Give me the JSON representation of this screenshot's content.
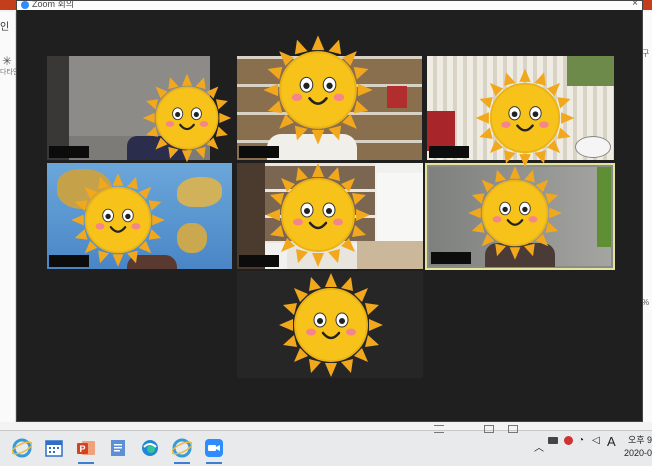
{
  "window": {
    "title": "Zoom 회의",
    "close_glyph": "×"
  },
  "background_app": {
    "left_label": "인",
    "left_sublabel": "다타인",
    "right_label_top": "구",
    "right_label_mid": "%"
  },
  "participants": [
    {
      "scene": "grey-room",
      "active": false,
      "overlay": "sun-emoji"
    },
    {
      "scene": "bookshelf",
      "active": false,
      "overlay": "sun-emoji"
    },
    {
      "scene": "curtain-room",
      "active": false,
      "overlay": "sun-emoji"
    },
    {
      "scene": "world-map",
      "active": false,
      "overlay": "sun-emoji"
    },
    {
      "scene": "office-shelves",
      "active": false,
      "overlay": "sun-emoji"
    },
    {
      "scene": "grey-wall",
      "active": true,
      "overlay": "sun-emoji"
    },
    {
      "scene": "dark",
      "active": false,
      "overlay": "sun-emoji"
    }
  ],
  "taskbar": {
    "apps": [
      {
        "name": "internet-explorer-icon",
        "color": "#3a9ad9"
      },
      {
        "name": "calendar-icon",
        "color": "#2f6fc6"
      },
      {
        "name": "powerpoint-icon",
        "color": "#d04423"
      },
      {
        "name": "word-doc-icon",
        "color": "#5b8fd6"
      },
      {
        "name": "edge-icon",
        "color": "#1f88d6"
      },
      {
        "name": "internet-explorer-icon-2",
        "color": "#3a9ad9"
      },
      {
        "name": "zoom-icon",
        "color": "#2d8cff"
      }
    ],
    "tray": {
      "ime": "A",
      "time": "오후 9",
      "date": "2020-0"
    }
  },
  "colors": {
    "zoom_bg": "#1f1f1f",
    "active_border": "#e6e39a",
    "sun_body": "#f7c21a",
    "sun_ray": "#f2a81d"
  }
}
